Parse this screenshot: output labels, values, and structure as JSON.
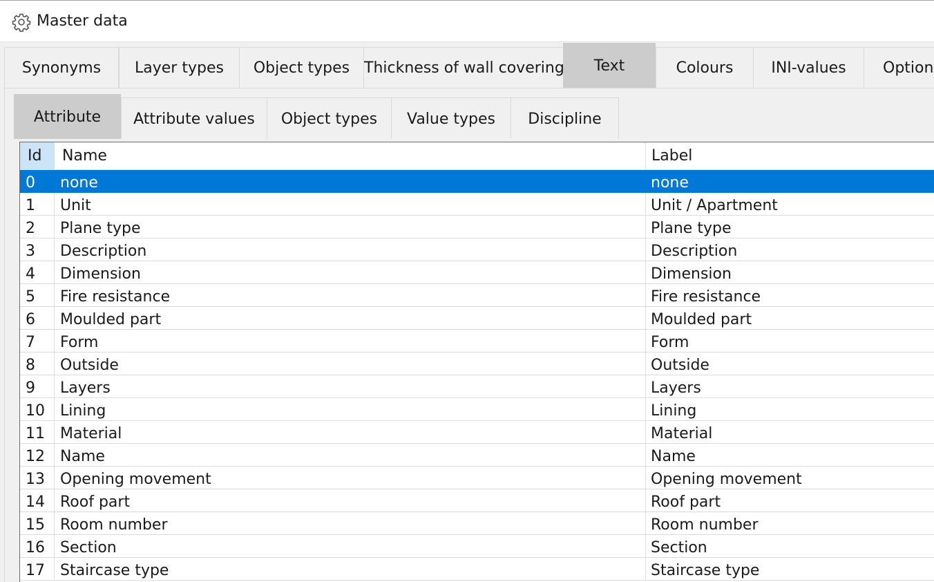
{
  "window": {
    "title": "Master data",
    "icon": "gear-icon"
  },
  "main_tabs": [
    {
      "label": "Synonyms",
      "active": false
    },
    {
      "label": "Layer types",
      "active": false
    },
    {
      "label": "Object types",
      "active": false
    },
    {
      "label": "Thickness of wall covering",
      "active": false
    },
    {
      "label": "Text",
      "active": true
    },
    {
      "label": "Colours",
      "active": false
    },
    {
      "label": "INI-values",
      "active": false
    },
    {
      "label": "Option",
      "active": false
    }
  ],
  "sub_tabs": [
    {
      "label": "Attribute",
      "active": true
    },
    {
      "label": "Attribute values",
      "active": false
    },
    {
      "label": "Object types",
      "active": false
    },
    {
      "label": "Value types",
      "active": false
    },
    {
      "label": "Discipline",
      "active": false
    }
  ],
  "grid": {
    "columns": [
      "Id",
      "Name",
      "Label"
    ],
    "selected_row": 0,
    "rows": [
      {
        "id": "0",
        "name": "none",
        "label": "none"
      },
      {
        "id": "1",
        "name": "Unit",
        "label": "Unit / Apartment"
      },
      {
        "id": "2",
        "name": "Plane type",
        "label": "Plane type"
      },
      {
        "id": "3",
        "name": "Description",
        "label": "Description"
      },
      {
        "id": "4",
        "name": "Dimension",
        "label": "Dimension"
      },
      {
        "id": "5",
        "name": "Fire resistance",
        "label": "Fire resistance"
      },
      {
        "id": "6",
        "name": "Moulded part",
        "label": "Moulded part"
      },
      {
        "id": "7",
        "name": "Form",
        "label": "Form"
      },
      {
        "id": "8",
        "name": "Outside",
        "label": "Outside"
      },
      {
        "id": "9",
        "name": "Layers",
        "label": "Layers"
      },
      {
        "id": "10",
        "name": "Lining",
        "label": "Lining"
      },
      {
        "id": "11",
        "name": "Material",
        "label": "Material"
      },
      {
        "id": "12",
        "name": "Name",
        "label": "Name"
      },
      {
        "id": "13",
        "name": "Opening movement",
        "label": "Opening movement"
      },
      {
        "id": "14",
        "name": "Roof part",
        "label": "Roof part"
      },
      {
        "id": "15",
        "name": "Room number",
        "label": "Room number"
      },
      {
        "id": "16",
        "name": "Section",
        "label": "Section"
      },
      {
        "id": "17",
        "name": "Staircase type",
        "label": "Staircase type"
      }
    ]
  },
  "colors": {
    "selection": "#0078d7",
    "active_tab": "#cccccc",
    "id_header": "#cce4f7"
  }
}
